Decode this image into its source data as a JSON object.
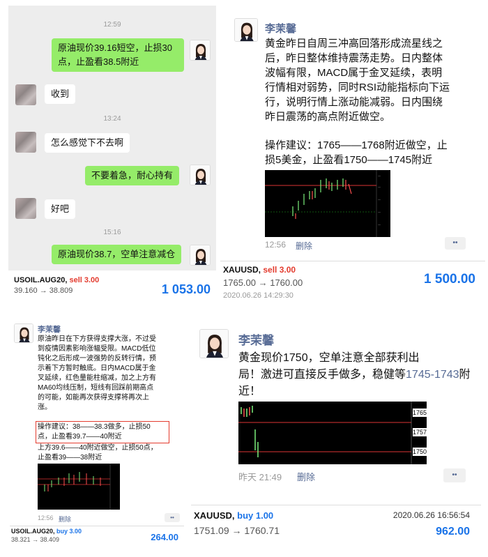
{
  "chat": {
    "time1": "12:59",
    "time2": "13:24",
    "time3": "15:16",
    "msg1": "原油现价39.16短空，止损30点，止盈看38.5附近",
    "msg2": "收到",
    "msg3": "怎么感觉下不去啊",
    "msg4": "不要着急，耐心持有",
    "msg5": "好吧",
    "msg6": "原油现价38.7，空单注意减仓",
    "trade": {
      "symbol": "USOIL.AUG20,",
      "side": "sell 3.00",
      "prices": "39.160 → 38.809",
      "amount": "1 053.00"
    }
  },
  "post1": {
    "name": "李茉馨",
    "text_lines": [
      "黄金昨日自周三冲高回落形成流星线之",
      "后，昨日整体维持震荡走势。日内整体",
      "波幅有限，MACD属于金叉延续，表明",
      "行情相对弱势，同时RSI动能指标向下运",
      "行，说明行情上涨动能减弱。日内围绕",
      "昨日震荡的高点附近做空。"
    ],
    "advice_lines": [
      "操作建议：1765——1768附近做空，止",
      "损5美金，止盈看1750——1745附近"
    ],
    "time": "12:56",
    "delete": "删除",
    "more": "••",
    "trade": {
      "symbol": "XAUUSD,",
      "side": "sell 3.00",
      "prices": "1765.00 → 1760.00",
      "date": "2020.06.26 14:29:30",
      "amount": "1 500.00"
    }
  },
  "post2": {
    "name": "李茉馨",
    "text_lines": [
      "原油昨日在下方获得支撑大涨，不过受",
      "到疫情因素影响涨幅受限。MACD低位",
      "钝化之后形成一波强势的反转行情，预",
      "示着下方暂时触底。日内MACD属于金",
      "叉延续，红色量能柱缩减，加之上方有",
      "MA60均线压制，短线有回踩前期高点",
      "的可能，如能再次获得支撑将再次上",
      "涨。"
    ],
    "advice_lines": [
      "操作建议：38——38.3做多，止损50",
      "点，止盈看39.7——40附近"
    ],
    "extra_lines": [
      "上方39.6——40附近做空，止损50点，",
      "止盈看39——38附近"
    ],
    "time": "12:56",
    "delete": "删除",
    "more": "••",
    "trade": {
      "symbol": "USOIL.AUG20,",
      "side": "buy 3.00",
      "prices": "38.321 → 38.409",
      "amount": "264.00"
    }
  },
  "post3": {
    "name": "李茉馨",
    "text_line1": "黄金现价1750，空单注意全部获利出",
    "text_line2": "局！激进可直接反手做多，稳健等",
    "text_highlight": "1745-1743",
    "text_end": "附近！",
    "time": "昨天 21:49",
    "delete": "删除",
    "more": "••",
    "chart_labels": [
      "1765",
      "1757",
      "1750"
    ],
    "trade": {
      "symbol": "XAUUSD,",
      "side": "buy 1.00",
      "date": "2020.06.26 16:56:54",
      "prices": "1751.09 → 1760.71",
      "amount": "962.00"
    }
  }
}
